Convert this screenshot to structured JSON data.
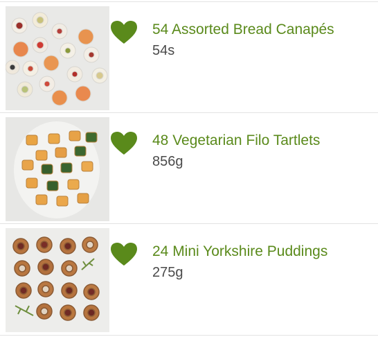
{
  "theme": {
    "title_color": "#5a8a1b",
    "heart_color": "#5a8a1b",
    "size_color": "#4a4a4a",
    "divider_color": "#e3e3e3"
  },
  "products": [
    {
      "name": "54 Assorted Bread Canapés",
      "size": "54s",
      "icon": "heart-icon"
    },
    {
      "name": "48 Vegetarian Filo Tartlets",
      "size": "856g",
      "icon": "heart-icon"
    },
    {
      "name": "24 Mini Yorkshire Puddings",
      "size": "275g",
      "icon": "heart-icon"
    }
  ]
}
